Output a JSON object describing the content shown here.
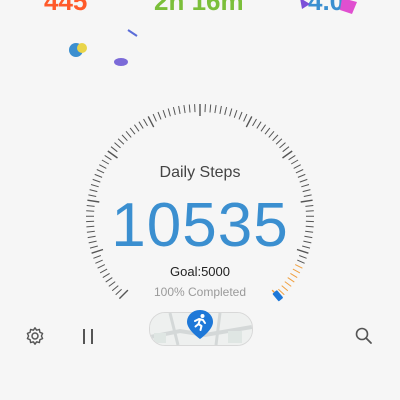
{
  "top_stats": {
    "left": "445",
    "mid": "2h 16m",
    "right": "4.0"
  },
  "main": {
    "title": "Daily Steps",
    "steps": "10535",
    "goal": "Goal:5000",
    "completed": "100% Completed"
  },
  "colors": {
    "steps": "#3b8fd0",
    "stat_left": "#ff5a2a",
    "stat_mid": "#7bbf3a",
    "stat_right": "#3b8fd0",
    "progress_accent": "#f0a040"
  },
  "bottom_bar": {
    "icons": [
      "gear-icon",
      "pause-icon",
      "map-runner-icon",
      "search-icon"
    ]
  }
}
